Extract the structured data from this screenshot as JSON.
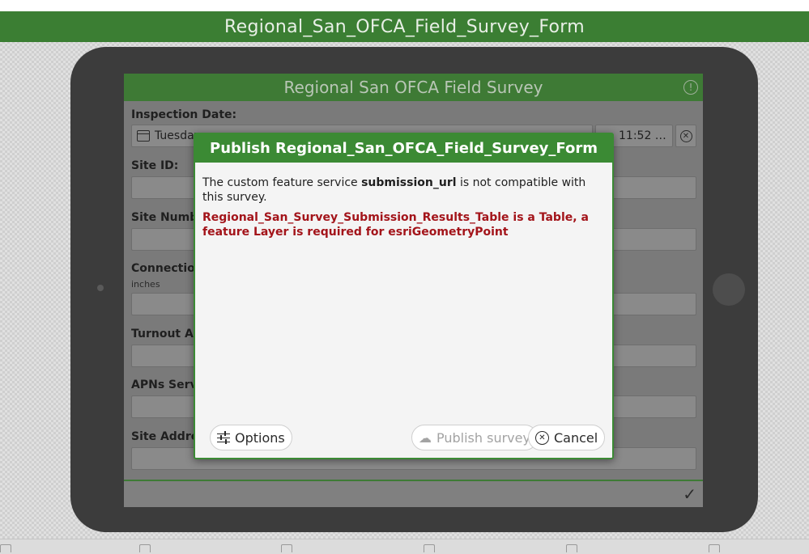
{
  "app_header": {
    "title": "Regional_San_OFCA_Field_Survey_Form"
  },
  "survey": {
    "title": "Regional San OFCA Field Survey",
    "fields": [
      {
        "label": "Inspection Date:"
      },
      {
        "label": "Site ID:"
      },
      {
        "label": "Site Number"
      },
      {
        "label": "Connection",
        "sublabel": "inches"
      },
      {
        "label": "Turnout APN"
      },
      {
        "label": "APNs Served"
      },
      {
        "label": "Site Address"
      }
    ],
    "date_value": "Tuesday",
    "time_value": "11:52 …"
  },
  "dialog": {
    "title": "Publish Regional_San_OFCA_Field_Survey_Form",
    "message_prefix": "The custom feature service",
    "message_bold": "submission_url",
    "message_suffix": "is not compatible with this survey.",
    "error": "Regional_San_Survey_Submission_Results_Table is a Table, a feature Layer is required for esriGeometryPoint",
    "options_label": "Options",
    "publish_label": "Publish survey",
    "cancel_label": "Cancel"
  }
}
